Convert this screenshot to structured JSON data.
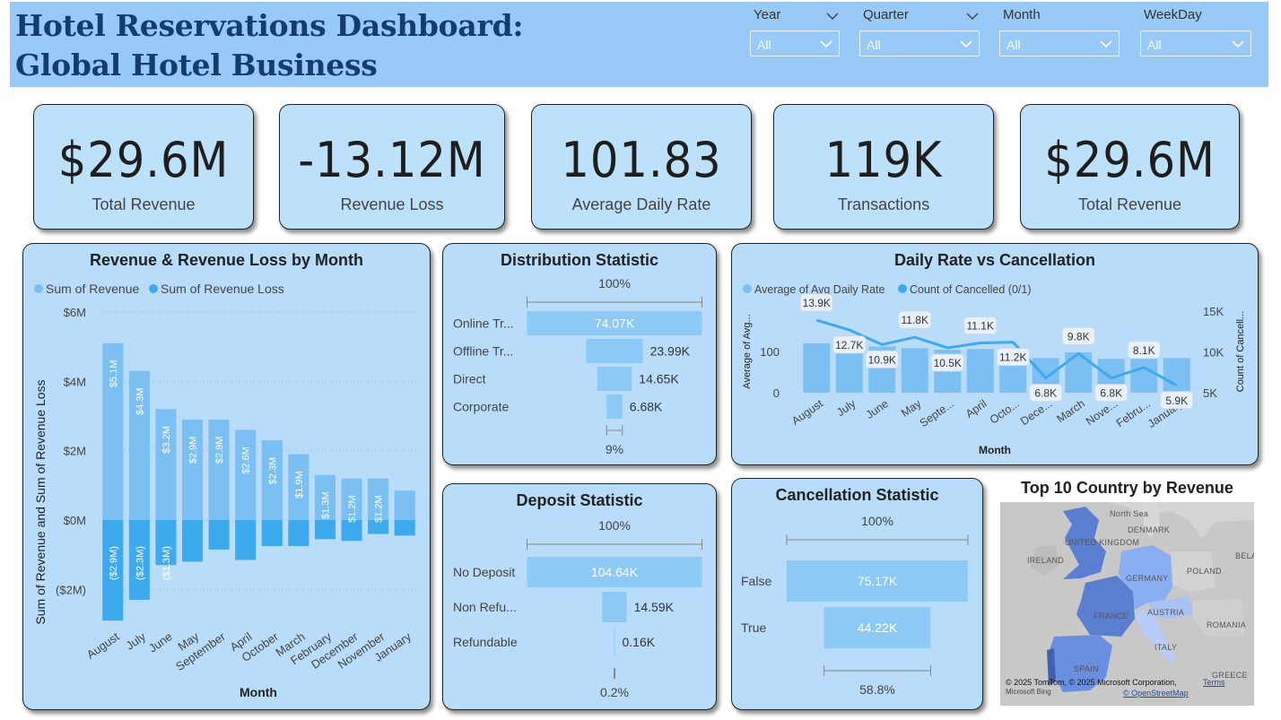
{
  "header": {
    "title_line1": "Hotel Reservations Dashboard:",
    "title_line2": "Global Hotel Business"
  },
  "slicers": [
    {
      "label": "Year",
      "value": "All"
    },
    {
      "label": "Quarter",
      "value": "All"
    },
    {
      "label": "Month",
      "value": "All"
    },
    {
      "label": "WeekDay",
      "value": "All"
    }
  ],
  "kpis": [
    {
      "value": "$29.6M",
      "label": "Total Revenue"
    },
    {
      "value": "-13.12M",
      "label": "Revenue Loss"
    },
    {
      "value": "101.83",
      "label": "Average Daily Rate"
    },
    {
      "value": "119K",
      "label": "Transactions"
    },
    {
      "value": "$29.6M",
      "label": "Total Revenue"
    }
  ],
  "colors": {
    "header_bg": "#98c9f7",
    "panel_bg": "#b9dcfa",
    "revenue": "#7cc0f3",
    "revenue_loss": "#3eaaee",
    "funnel_bar": "#8ccaf5",
    "title": "#143c6e"
  },
  "panels": {
    "revenue_by_month": {
      "title": "Revenue & Revenue Loss by Month"
    },
    "distribution": {
      "title": "Distribution Statistic"
    },
    "daily_rate": {
      "title": "Daily Rate vs Cancellation"
    },
    "deposit": {
      "title": "Deposit Statistic"
    },
    "cancellation": {
      "title": "Cancellation Statistic"
    },
    "map": {
      "title": "Top 10 Country by Revenue",
      "credit": "© 2025 TomTom, © 2025 Microsoft Corporation,",
      "terms": "Terms",
      "osm": "© OpenStreetMap",
      "bing": "Microsoft Bing",
      "labels": [
        "North Sea",
        "DENMARK",
        "UNITED KINGDOM",
        "IRELAND",
        "POLAND",
        "GERMANY",
        "BELA",
        "FRANCE",
        "AUSTRIA",
        "ROMANIA",
        "ITALY",
        "SPAIN",
        "GREECE"
      ]
    }
  },
  "chart_data": [
    {
      "type": "bar",
      "title": "Revenue & Revenue Loss by Month",
      "xlabel": "Month",
      "ylabel": "Sum of Revenue and Sum of Revenue Loss",
      "legend": "top-left",
      "ylim": [
        -2.8,
        6.2
      ],
      "yticks": [
        {
          "v": 6,
          "t": "$6M"
        },
        {
          "v": 4,
          "t": "$4M"
        },
        {
          "v": 2,
          "t": "$2M"
        },
        {
          "v": 0,
          "t": "$0M"
        },
        {
          "v": -2,
          "t": "($2M)"
        }
      ],
      "categories": [
        "August",
        "July",
        "June",
        "May",
        "September",
        "April",
        "October",
        "March",
        "February",
        "December",
        "November",
        "January"
      ],
      "series": [
        {
          "name": "Sum of Revenue",
          "values": [
            5.1,
            4.3,
            3.2,
            2.9,
            2.9,
            2.6,
            2.3,
            1.9,
            1.3,
            1.2,
            1.2,
            0.85
          ],
          "labels": [
            "$5.1M",
            "$4.3M",
            "$3.2M",
            "$2.9M",
            "$2.9M",
            "$2.6M",
            "$2.3M",
            "$1.9M",
            "$1.3M",
            "$1.2M",
            "$1.2M",
            ""
          ]
        },
        {
          "name": "Sum of Revenue Loss",
          "values": [
            -2.9,
            -2.3,
            -1.3,
            -1.2,
            -0.85,
            -1.15,
            -0.75,
            -0.75,
            -0.55,
            -0.6,
            -0.4,
            -0.45
          ],
          "labels": [
            "($2.9M)",
            "($2.3M)",
            "($1.3M)",
            "",
            "",
            "",
            "",
            "",
            "",
            "",
            "",
            ""
          ]
        }
      ]
    },
    {
      "type": "bar",
      "subtype": "funnel",
      "title": "Distribution Statistic",
      "top_pct": "100%",
      "bottom_pct": "9%",
      "categories": [
        "Online Tr...",
        "Offline Tr...",
        "Direct",
        "Corporate"
      ],
      "values": [
        74.07,
        23.99,
        14.65,
        6.68
      ],
      "labels": [
        "74.07K",
        "23.99K",
        "14.65K",
        "6.68K"
      ]
    },
    {
      "type": "bar",
      "subtype": "combo-line",
      "title": "Daily Rate vs Cancellation",
      "xlabel": "Month",
      "ylabel": "Average of Avg...",
      "y2label": "Count of Cancell...",
      "legend": "top-left",
      "categories": [
        "August",
        "July",
        "June",
        "May",
        "Septe...",
        "April",
        "Octo...",
        "Dece...",
        "March",
        "Nove...",
        "Febru...",
        "January"
      ],
      "yticks": [
        {
          "v": 0,
          "t": "0"
        },
        {
          "v": 100,
          "t": "100"
        }
      ],
      "y2ticks": [
        {
          "v": 5,
          "t": "5K"
        },
        {
          "v": 10,
          "t": "10K"
        },
        {
          "v": 15,
          "t": "15K"
        }
      ],
      "series": [
        {
          "name": "Average of Avg Daily Rate",
          "axis": "left",
          "values": [
            120,
            124,
            112,
            108,
            104,
            106,
            101,
            84,
            98,
            82,
            90,
            84
          ]
        },
        {
          "name": "Count of Cancelled (0/1)",
          "axis": "right",
          "values": [
            13.9,
            12.7,
            10.9,
            11.8,
            10.5,
            11.1,
            11.2,
            6.8,
            9.8,
            6.8,
            8.1,
            5.9
          ],
          "labels": [
            "13.9K",
            "12.7K",
            "10.9K",
            "11.8K",
            "10.5K",
            "11.1K",
            "11.2K",
            "6.8K",
            "9.8K",
            "6.8K",
            "8.1K",
            "5.9K"
          ]
        }
      ]
    },
    {
      "type": "bar",
      "subtype": "funnel",
      "title": "Deposit Statistic",
      "top_pct": "100%",
      "bottom_pct": "0.2%",
      "categories": [
        "No Deposit",
        "Non Refu...",
        "Refundable"
      ],
      "values": [
        104.64,
        14.59,
        0.16
      ],
      "labels": [
        "104.64K",
        "14.59K",
        "0.16K"
      ]
    },
    {
      "type": "bar",
      "subtype": "funnel",
      "title": "Cancellation Statistic",
      "top_pct": "100%",
      "bottom_pct": "58.8%",
      "categories": [
        "False",
        "True"
      ],
      "values": [
        75.17,
        44.22
      ],
      "labels": [
        "75.17K",
        "44.22K"
      ]
    }
  ]
}
